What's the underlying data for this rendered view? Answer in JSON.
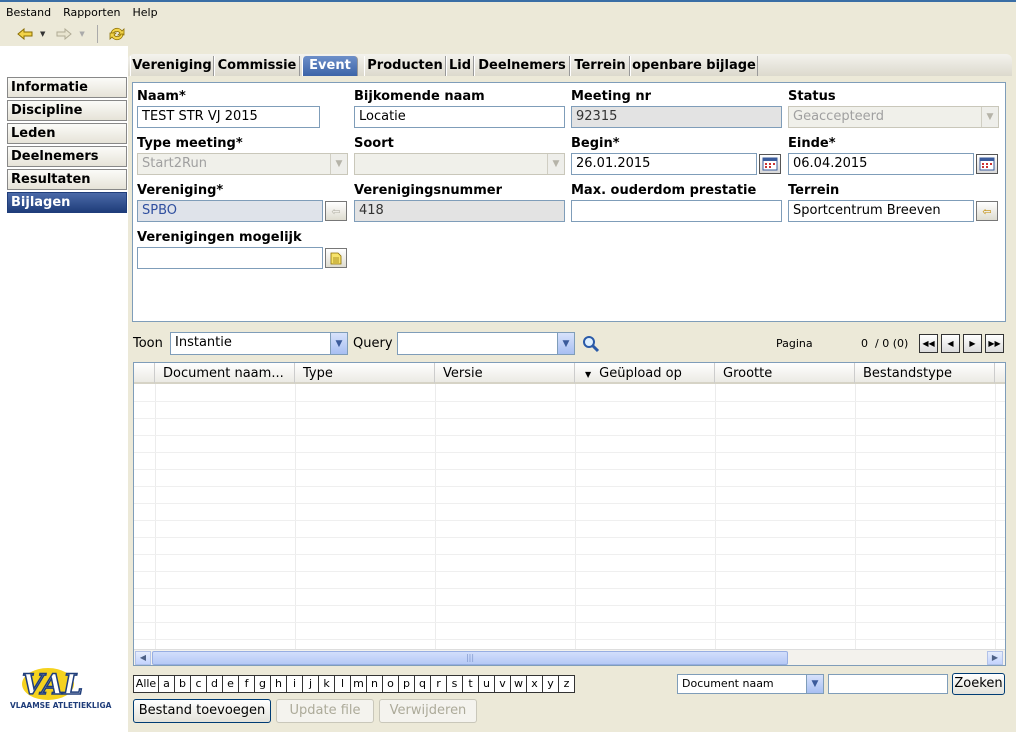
{
  "menu": [
    "Bestand",
    "Rapporten",
    "Help"
  ],
  "toolbar": {
    "back_icon": "arrow-left-icon",
    "forward_icon": "arrow-right-icon",
    "refresh_icon": "refresh-icon"
  },
  "sidebar": {
    "items": [
      {
        "label": "Informatie"
      },
      {
        "label": "Discipline"
      },
      {
        "label": "Leden"
      },
      {
        "label": "Deelnemers"
      },
      {
        "label": "Resultaten"
      },
      {
        "label": "Bijlagen",
        "active": true
      }
    ],
    "logo_text": "VAL",
    "logo_subtitle": "VLAAMSE ATLETIEKLIGA"
  },
  "tabs": [
    {
      "label": "Vereniging"
    },
    {
      "label": "Commissie"
    },
    {
      "label": "Event",
      "active": true
    },
    {
      "label": "Producten"
    },
    {
      "label": "Lid"
    },
    {
      "label": "Deelnemers"
    },
    {
      "label": "Terrein"
    },
    {
      "label": "openbare bijlage"
    }
  ],
  "form": {
    "naam_label": "Naam*",
    "naam_value": "TEST STR VJ 2015",
    "bijkomende_label": "Bijkomende naam",
    "bijkomende_value": "Locatie",
    "meeting_nr_label": "Meeting nr",
    "meeting_nr_value": "92315",
    "status_label": "Status",
    "status_value": "Geaccepteerd",
    "type_label": "Type meeting*",
    "type_value": "Start2Run",
    "soort_label": "Soort",
    "soort_value": "",
    "begin_label": "Begin*",
    "begin_value": "26.01.2015",
    "einde_label": "Einde*",
    "einde_value": "06.04.2015",
    "vereniging_label": "Vereniging*",
    "vereniging_value": "SPBO",
    "vernummer_label": "Verenigingsnummer",
    "vernummer_value": "418",
    "maxouderdom_label": "Max. ouderdom prestatie",
    "maxouderdom_value": "",
    "terrein_label": "Terrein",
    "terrein_value": "Sportcentrum Breeven",
    "mogelijk_label": "Verenigingen mogelijk",
    "mogelijk_value": ""
  },
  "filter": {
    "toon_label": "Toon",
    "toon_value": "Instantie",
    "query_label": "Query",
    "query_value": "",
    "pagina_label": "Pagina",
    "pagina_value": "0  / 0 (0)"
  },
  "grid": {
    "columns": [
      "Document naam...",
      "Type",
      "Versie",
      "Geüpload op",
      "Grootte",
      "Bestandstype"
    ],
    "sorted_column": "Geüpload op",
    "rows": []
  },
  "alphabet": [
    "Alle",
    "a",
    "b",
    "c",
    "d",
    "e",
    "f",
    "g",
    "h",
    "i",
    "j",
    "k",
    "l",
    "m",
    "n",
    "o",
    "p",
    "q",
    "r",
    "s",
    "t",
    "u",
    "v",
    "w",
    "x",
    "y",
    "z"
  ],
  "search": {
    "field_value": "Document naam",
    "input_value": "",
    "button_label": "Zoeken"
  },
  "actions": {
    "add": "Bestand toevoegen",
    "update": "Update file",
    "delete": "Verwijderen"
  }
}
